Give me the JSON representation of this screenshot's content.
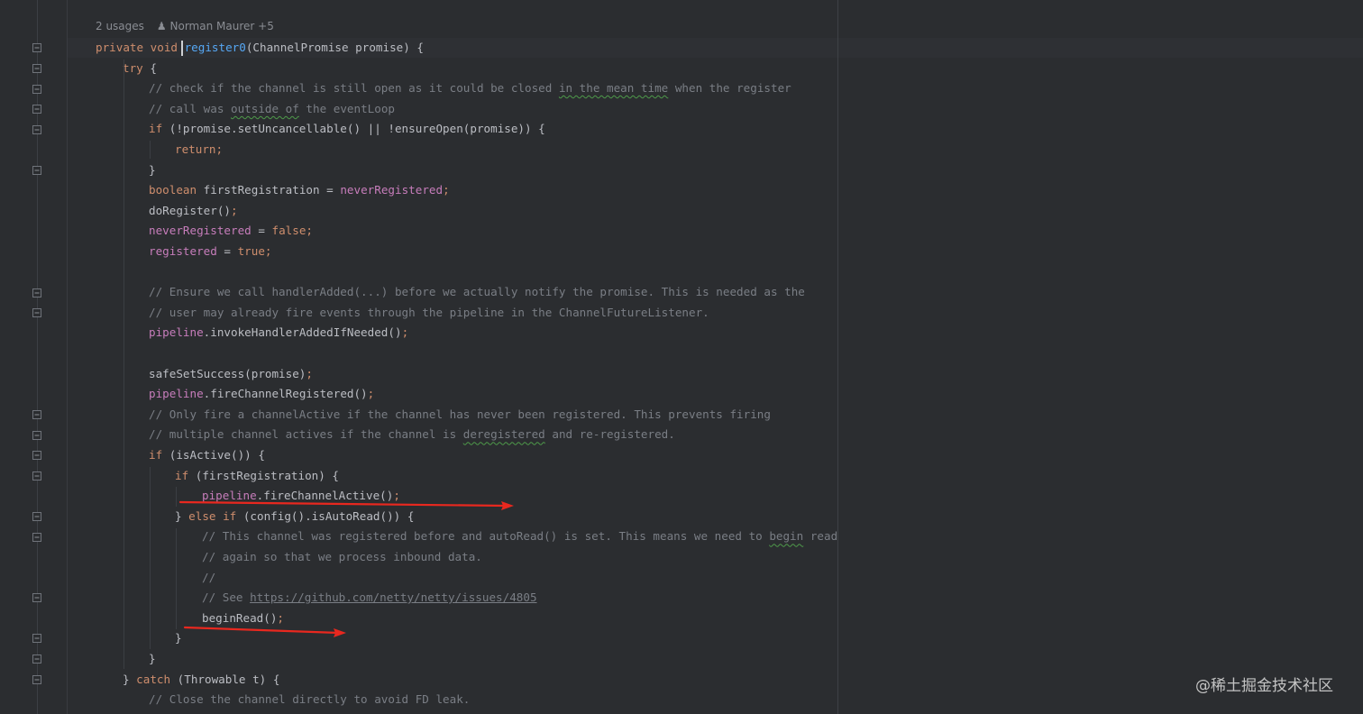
{
  "inlay_hint": {
    "usages": "2 usages",
    "author": "Norman Maurer +5"
  },
  "code_lines": [
    {
      "tokens": [
        {
          "t": "private ",
          "c": "kw"
        },
        {
          "t": "void ",
          "c": "kw"
        },
        {
          "t": "register0",
          "c": "fn"
        },
        {
          "t": "(ChannelPromise promise) {",
          "c": "pl"
        }
      ]
    },
    {
      "tokens": [
        {
          "t": "try ",
          "c": "kw"
        },
        {
          "t": "{",
          "c": "pl"
        }
      ]
    },
    {
      "tokens": [
        {
          "t": "// check if the channel is still open as it could be closed ",
          "c": "cm"
        },
        {
          "t": "in the mean time",
          "c": "cm typo"
        },
        {
          "t": " when the register",
          "c": "cm"
        }
      ]
    },
    {
      "tokens": [
        {
          "t": "// call was ",
          "c": "cm"
        },
        {
          "t": "outside of",
          "c": "cm typo"
        },
        {
          "t": " the eventLoop",
          "c": "cm"
        }
      ]
    },
    {
      "tokens": [
        {
          "t": "if ",
          "c": "kw"
        },
        {
          "t": "(!promise.setUncancellable() || !ensureOpen(promise)) {",
          "c": "pl"
        }
      ]
    },
    {
      "tokens": [
        {
          "t": "return",
          "c": "kw"
        },
        {
          "t": ";",
          "c": "semi"
        }
      ]
    },
    {
      "tokens": [
        {
          "t": "}",
          "c": "pl"
        }
      ]
    },
    {
      "tokens": [
        {
          "t": "boolean ",
          "c": "kw"
        },
        {
          "t": "firstRegistration = ",
          "c": "pl"
        },
        {
          "t": "neverRegistered",
          "c": "field"
        },
        {
          "t": ";",
          "c": "semi"
        }
      ]
    },
    {
      "tokens": [
        {
          "t": "doRegister()",
          "c": "pl"
        },
        {
          "t": ";",
          "c": "semi"
        }
      ]
    },
    {
      "tokens": [
        {
          "t": "neverRegistered",
          "c": "field"
        },
        {
          "t": " = ",
          "c": "pl"
        },
        {
          "t": "false",
          "c": "kw"
        },
        {
          "t": ";",
          "c": "semi"
        }
      ]
    },
    {
      "tokens": [
        {
          "t": "registered",
          "c": "field"
        },
        {
          "t": " = ",
          "c": "pl"
        },
        {
          "t": "true",
          "c": "kw"
        },
        {
          "t": ";",
          "c": "semi"
        }
      ]
    },
    {
      "tokens": []
    },
    {
      "tokens": [
        {
          "t": "// Ensure we call handlerAdded(...) before we actually notify the promise. This is needed as the",
          "c": "cm"
        }
      ]
    },
    {
      "tokens": [
        {
          "t": "// user may already fire events through the pipeline in the ChannelFutureListener.",
          "c": "cm"
        }
      ]
    },
    {
      "tokens": [
        {
          "t": "pipeline",
          "c": "field"
        },
        {
          "t": ".invokeHandlerAddedIfNeeded()",
          "c": "pl"
        },
        {
          "t": ";",
          "c": "semi"
        }
      ]
    },
    {
      "tokens": []
    },
    {
      "tokens": [
        {
          "t": "safeSetSuccess(promise)",
          "c": "pl"
        },
        {
          "t": ";",
          "c": "semi"
        }
      ]
    },
    {
      "tokens": [
        {
          "t": "pipeline",
          "c": "field"
        },
        {
          "t": ".fireChannelRegistered()",
          "c": "pl"
        },
        {
          "t": ";",
          "c": "semi"
        }
      ]
    },
    {
      "tokens": [
        {
          "t": "// Only fire a channelActive if the channel has never been registered. This prevents firing",
          "c": "cm"
        }
      ]
    },
    {
      "tokens": [
        {
          "t": "// multiple channel actives if the channel is ",
          "c": "cm"
        },
        {
          "t": "deregistered",
          "c": "cm typo"
        },
        {
          "t": " and re-registered.",
          "c": "cm"
        }
      ]
    },
    {
      "tokens": [
        {
          "t": "if ",
          "c": "kw"
        },
        {
          "t": "(isActive()) {",
          "c": "pl"
        }
      ]
    },
    {
      "tokens": [
        {
          "t": "if ",
          "c": "kw"
        },
        {
          "t": "(firstRegistration) {",
          "c": "pl"
        }
      ]
    },
    {
      "tokens": [
        {
          "t": "pipeline",
          "c": "field"
        },
        {
          "t": ".fireChannelActive()",
          "c": "pl"
        },
        {
          "t": ";",
          "c": "semi"
        }
      ]
    },
    {
      "tokens": [
        {
          "t": "} ",
          "c": "pl"
        },
        {
          "t": "else if ",
          "c": "kw"
        },
        {
          "t": "(config().isAutoRead()) {",
          "c": "pl"
        }
      ]
    },
    {
      "tokens": [
        {
          "t": "// This channel was registered before and autoRead() is set. This means we need to ",
          "c": "cm"
        },
        {
          "t": "begin",
          "c": "cm typo"
        },
        {
          "t": " read",
          "c": "cm"
        }
      ]
    },
    {
      "tokens": [
        {
          "t": "// again so that we process inbound data.",
          "c": "cm"
        }
      ]
    },
    {
      "tokens": [
        {
          "t": "//",
          "c": "cm"
        }
      ]
    },
    {
      "tokens": [
        {
          "t": "// See ",
          "c": "cm"
        },
        {
          "t": "https://github.com/netty/netty/issues/4805",
          "c": "link"
        }
      ]
    },
    {
      "tokens": [
        {
          "t": "beginRead()",
          "c": "pl"
        },
        {
          "t": ";",
          "c": "semi"
        }
      ]
    },
    {
      "tokens": [
        {
          "t": "}",
          "c": "pl"
        }
      ]
    },
    {
      "tokens": [
        {
          "t": "}",
          "c": "pl"
        }
      ]
    },
    {
      "tokens": [
        {
          "t": "} ",
          "c": "pl"
        },
        {
          "t": "catch ",
          "c": "kw"
        },
        {
          "t": "(Throwable t) {",
          "c": "pl"
        }
      ]
    },
    {
      "tokens": [
        {
          "t": "// Close the channel directly to avoid FD leak.",
          "c": "cm"
        }
      ]
    }
  ],
  "watermark": "@稀土掘金技术社区",
  "colors": {
    "background": "#2b2d30",
    "keyword": "#cf8e6d",
    "function": "#56a8f5",
    "field": "#c77dbb",
    "comment": "#7a7e85",
    "plain": "#bcbec4",
    "annotation_arrow": "#e8281f"
  }
}
